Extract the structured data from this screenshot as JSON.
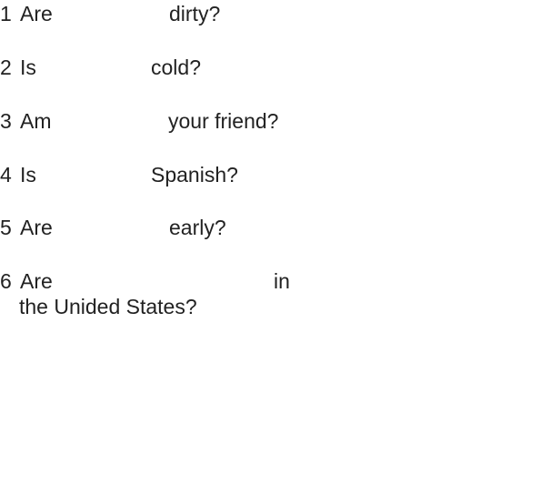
{
  "items": [
    {
      "number": "1",
      "start": "Are",
      "end": "dirty?"
    },
    {
      "number": "2",
      "start": "Is",
      "end": "cold?"
    },
    {
      "number": "3",
      "start": "Am",
      "end": "your friend?"
    },
    {
      "number": "4",
      "start": "Is",
      "end": "Spanish?"
    },
    {
      "number": "5",
      "start": "Are",
      "end": "early?"
    },
    {
      "number": "6",
      "start": "Are",
      "end": "in",
      "continuation": "the Unided States?"
    }
  ]
}
